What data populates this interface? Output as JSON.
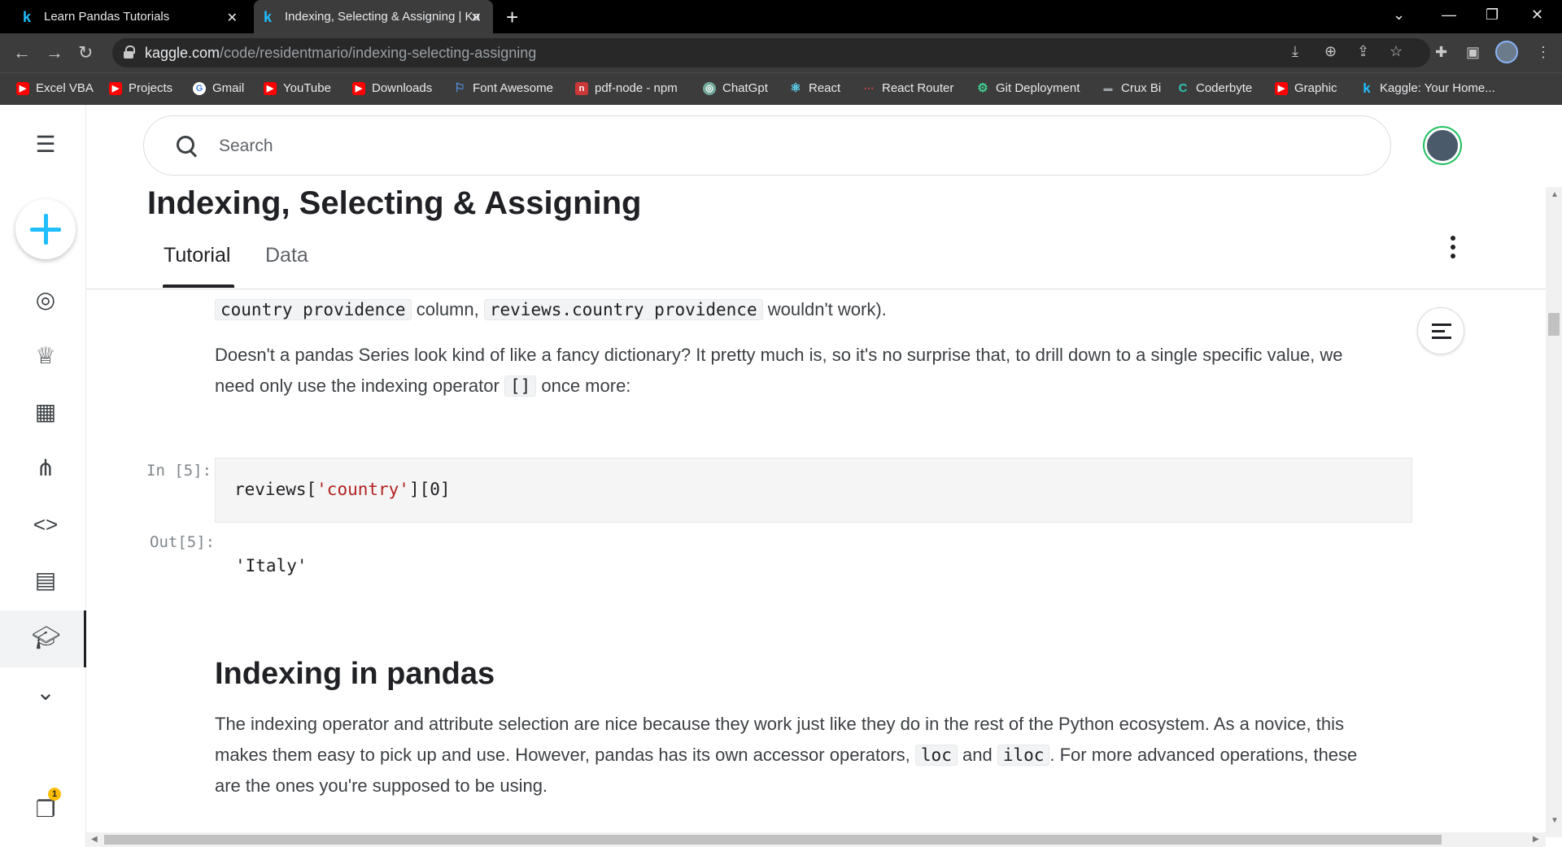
{
  "browser": {
    "tabs": [
      {
        "title": "Learn Pandas Tutorials",
        "active": false
      },
      {
        "title": "Indexing, Selecting & Assigning | Kaggle",
        "active": true
      }
    ],
    "url_host": "kaggle.com",
    "url_path": "/code/residentmario/indexing-selecting-assigning",
    "bookmarks": [
      {
        "label": "Excel VBA",
        "icon": "youtube-icon",
        "color": "#ff0000"
      },
      {
        "label": "Projects",
        "icon": "youtube-icon",
        "color": "#ff0000"
      },
      {
        "label": "Gmail",
        "icon": "google-icon",
        "color": "#4285f4"
      },
      {
        "label": "YouTube",
        "icon": "youtube-icon",
        "color": "#ff0000"
      },
      {
        "label": "Downloads",
        "icon": "youtube-icon",
        "color": "#ff0000"
      },
      {
        "label": "Font Awesome",
        "icon": "flag-icon",
        "color": "#538dd7"
      },
      {
        "label": "pdf-node - npm",
        "icon": "npm-icon",
        "color": "#cb3837"
      },
      {
        "label": "ChatGpt",
        "icon": "chatgpt-icon",
        "color": "#74aa9c"
      },
      {
        "label": "React",
        "icon": "react-icon",
        "color": "#61dafb"
      },
      {
        "label": "React Router",
        "icon": "react-router-icon",
        "color": "#ca4245"
      },
      {
        "label": "Git Deployment",
        "icon": "gear-icon",
        "color": "#3ecf8e"
      },
      {
        "label": "Crux Bi",
        "icon": "crux-icon",
        "color": "#9aa0a6"
      },
      {
        "label": "Coderbyte",
        "icon": "coderbyte-icon",
        "color": "#2ec4b6"
      },
      {
        "label": "Graphic",
        "icon": "youtube-icon",
        "color": "#ff0000"
      },
      {
        "label": "Kaggle: Your Home...",
        "icon": "kaggle-icon",
        "color": "#20beff"
      }
    ]
  },
  "kaggle": {
    "search_placeholder": "Search",
    "page_title": "Indexing, Selecting & Assigning",
    "tabs": [
      "Tutorial",
      "Data"
    ],
    "notification_count": "1",
    "content": {
      "line1_code_a": "country providence",
      "line1_text_b": "column,",
      "line1_code_c": "reviews.country providence",
      "line1_text_d": "wouldn't work).",
      "para2_a": "Doesn't a pandas Series look kind of like a fancy dictionary? It pretty much is, so it's no surprise that, to drill down to a single specific value, we need only use the indexing operator",
      "para2_code": "[]",
      "para2_b": "once more:",
      "in_label": "In [5]:",
      "code_prefix": "reviews[",
      "code_string": "'country'",
      "code_suffix": "][0]",
      "out_label": "Out[5]:",
      "output": "'Italy'",
      "heading": "Indexing in pandas",
      "para3_a": "The indexing operator and attribute selection are nice because they work just like they do in the rest of the Python ecosystem. As a novice, this makes them easy to pick up and use. However, pandas has its own accessor operators,",
      "para3_code1": "loc",
      "para3_and": "and",
      "para3_code2": "iloc",
      "para3_b": ". For more advanced operations, these are the ones you're supposed to be using."
    }
  }
}
